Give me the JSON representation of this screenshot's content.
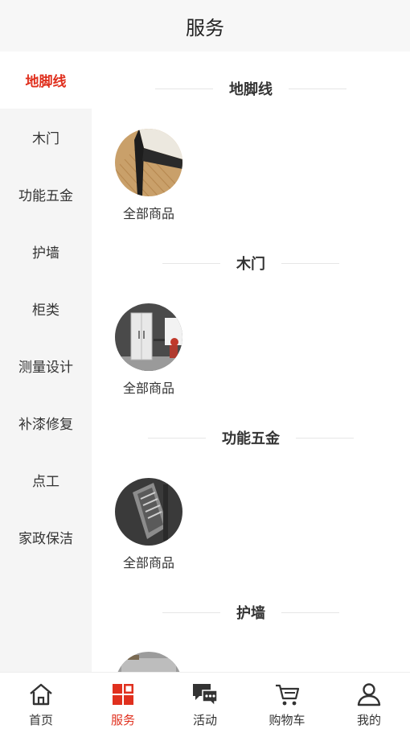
{
  "header": {
    "title": "服务"
  },
  "sidebar": {
    "items": [
      {
        "label": "地脚线"
      },
      {
        "label": "木门"
      },
      {
        "label": "功能五金"
      },
      {
        "label": "护墙"
      },
      {
        "label": "柜类"
      },
      {
        "label": "测量设计"
      },
      {
        "label": "补漆修复"
      },
      {
        "label": "点工"
      },
      {
        "label": "家政保洁"
      }
    ],
    "active_index": 0
  },
  "sections": [
    {
      "title": "地脚线",
      "items": [
        {
          "label": "全部商品"
        }
      ]
    },
    {
      "title": "木门",
      "items": [
        {
          "label": "全部商品"
        }
      ]
    },
    {
      "title": "功能五金",
      "items": [
        {
          "label": "全部商品"
        }
      ]
    },
    {
      "title": "护墙",
      "items": []
    }
  ],
  "tabbar": {
    "tabs": [
      {
        "label": "首页",
        "icon": "home-icon"
      },
      {
        "label": "服务",
        "icon": "grid-icon"
      },
      {
        "label": "活动",
        "icon": "chat-icon"
      },
      {
        "label": "购物车",
        "icon": "cart-icon"
      },
      {
        "label": "我的",
        "icon": "user-icon"
      }
    ],
    "active_index": 1
  },
  "colors": {
    "accent": "#e0301e",
    "header_bg": "#f7f7f7",
    "sidebar_bg": "#f5f5f5"
  }
}
